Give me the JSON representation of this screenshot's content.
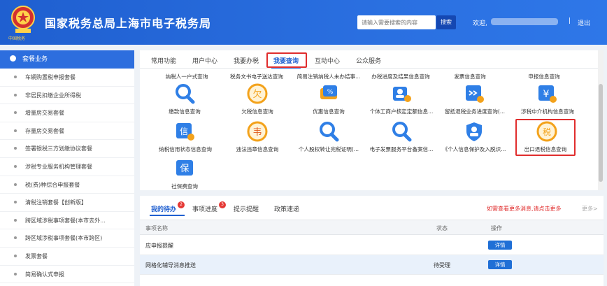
{
  "header": {
    "emblem_caption": "中国税务",
    "title": "国家税务总局上海市电子税务局",
    "search_placeholder": "请输入需要搜索的内容",
    "search_button": "搜索",
    "welcome": "欢迎,",
    "separator": "|",
    "logout": "退出"
  },
  "sidebar": {
    "header": "套餐业务",
    "items": [
      "车辆购置税申报套餐",
      "非居民扣缴企业所得税",
      "增量房交易套餐",
      "存量房交易套餐",
      "签署银税三方划缴协议套餐",
      "涉税专业服务机构管理套餐",
      "税(费)种综合申报套餐",
      "清税注销套餐【创新版】",
      "跨区域涉税事项套餐(本市去外...",
      "跨区域涉税事项套餐(本市跨区)",
      "发票套餐",
      "简易确认式申报"
    ]
  },
  "main_tabs": [
    "常用功能",
    "用户中心",
    "我要办税",
    "我要查询",
    "互动中心",
    "公众服务"
  ],
  "top_labels": [
    "纳税人一户式查询",
    "税务文书电子送达查询",
    "简易注销纳税人未办结事...",
    "办税进度及结果信息查询",
    "发票信息查询",
    "申报信息查询"
  ],
  "icons_row1": [
    {
      "label": "缴款信息查询",
      "icon": "search-icon"
    },
    {
      "label": "欠税信息查询",
      "icon": "owed-tax-icon",
      "glyph": "欠"
    },
    {
      "label": "优惠信息查询",
      "icon": "discount-icon",
      "glyph": "%"
    },
    {
      "label": "个体工商户核定定额信息...",
      "icon": "business-quota-icon"
    },
    {
      "label": "留抵退税业务进度查询(...",
      "icon": "refund-progress-icon"
    },
    {
      "label": "涉税中介机构信息查询",
      "icon": "agency-icon",
      "glyph": "¥"
    }
  ],
  "icons_row2": [
    {
      "label": "纳税信用状态信息查询",
      "icon": "credit-icon",
      "glyph": "信"
    },
    {
      "label": "违法违章信息查询",
      "icon": "violation-icon",
      "glyph": "韦"
    },
    {
      "label": "个人股权转让完税证明(...",
      "icon": "search-icon"
    },
    {
      "label": "电子发票服务平台备案信...",
      "icon": "search-icon"
    },
    {
      "label": "《个人信息保护及入脱识...",
      "icon": "privacy-icon"
    },
    {
      "label": "出口退税信息查询",
      "icon": "export-refund-icon",
      "glyph": "税"
    }
  ],
  "icons_row3": [
    {
      "label": "社保费查询",
      "icon": "social-security-icon",
      "glyph": "保"
    }
  ],
  "todo": {
    "tabs": [
      {
        "label": "我的待办",
        "badge": "2"
      },
      {
        "label": "事项进度",
        "badge": "3"
      },
      {
        "label": "提示提醒",
        "badge": ""
      },
      {
        "label": "政策速递",
        "badge": ""
      }
    ],
    "notice": "如需查看更多消息,请点击更多",
    "more": "更多>",
    "columns": [
      "事项名称",
      "状态",
      "操作"
    ],
    "rows": [
      {
        "name": "应申报提醒",
        "status": "",
        "action": "详情"
      },
      {
        "name": "网格化辅导消息推送",
        "status": "待受理",
        "action": "详情"
      }
    ]
  },
  "colors": {
    "brand": "#1f5fd0",
    "highlight": "#e02d2d",
    "button": "#1f6fd6"
  }
}
